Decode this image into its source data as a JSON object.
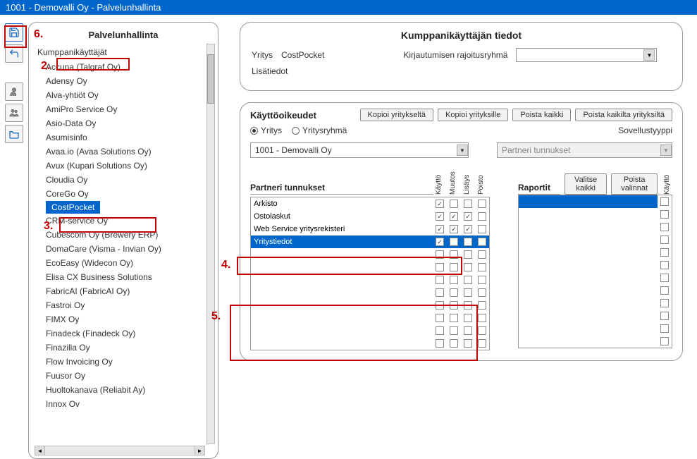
{
  "titlebar": "1001 - Demovalli Oy - Palvelunhallinta",
  "sidebar": {
    "title": "Palvelunhallinta",
    "parent": "Kumppanikäyttäjät",
    "items": [
      "Accuna (Talgraf Oy)",
      "Adensy Oy",
      "Alva-yhtiöt Oy",
      "AmiPro Service Oy",
      "Asio-Data Oy",
      "Asumisinfo",
      "Avaa.io (Avaa Solutions Oy)",
      "Avux (Kupari Solutions Oy)",
      "Cloudia Oy",
      "CoreGo Oy",
      "CostPocket",
      "CRM-service Oy",
      "Cubescom Oy (Brewery ERP)",
      "DomaCare (Visma - Invian Oy)",
      "EcoEasy (Widecon Oy)",
      "Elisa CX Business Solutions",
      "FabricAI (FabricAI Oy)",
      "Fastroi Oy",
      "FIMX Oy",
      "Finadeck (Finadeck Oy)",
      "Finazilla Oy",
      "Flow Invoicing Oy",
      "Fuusor Oy",
      "Huoltokanava (Reliabit Ay)",
      "Innox Ov"
    ],
    "selected_index": 10
  },
  "top_panel": {
    "title": "Kumppanikäyttäjän tiedot",
    "company_label": "Yritys",
    "company_value": "CostPocket",
    "restrict_label": "Kirjautumisen rajoitusryhmä",
    "details_label": "Lisätiedot"
  },
  "perm_panel": {
    "title": "Käyttöoikeudet",
    "buttons": {
      "copy_from": "Kopioi yritykseltä",
      "copy_to": "Kopioi yrityksille",
      "remove_all": "Poista kaikki",
      "remove_all_companies": "Poista kaikilta yrityksiltä"
    },
    "radios": {
      "company": "Yritys",
      "group": "Yritysryhmä",
      "selected": "company"
    },
    "company_combo": "1001 - Demovalli Oy",
    "app_type_label": "Sovellustyyppi",
    "app_type_value": "Partneri tunnukset",
    "table_left": {
      "title": "Partneri tunnukset",
      "cols": [
        "Käyttö",
        "Muutos",
        "Lisäys",
        "Poisto"
      ],
      "rows": [
        {
          "name": "Arkisto",
          "c": [
            true,
            false,
            false,
            false
          ]
        },
        {
          "name": "Ostolaskut",
          "c": [
            true,
            true,
            true,
            false
          ]
        },
        {
          "name": "Web Service yritysrekisteri",
          "c": [
            true,
            true,
            true,
            false
          ]
        },
        {
          "name": "Yritystiedot",
          "c": [
            true,
            false,
            false,
            false
          ],
          "sel": true
        }
      ],
      "blank_rows": 8
    },
    "table_right": {
      "title": "Raportit",
      "buttons": {
        "select_all": "Valitse kaikki",
        "clear": "Poista valinnat"
      },
      "col": "Käyttö",
      "blank_rows": 11
    }
  },
  "annotations": {
    "a2": "2.",
    "a3": "3.",
    "a4": "4.",
    "a5": "5.",
    "a6": "6."
  }
}
